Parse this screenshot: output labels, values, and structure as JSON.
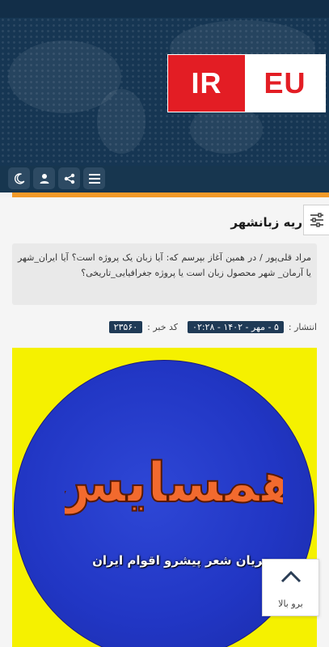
{
  "header": {
    "logo_left": "IR",
    "logo_right": "EU"
  },
  "toolbar": {
    "buttons": [
      {
        "icon": "moon-icon"
      },
      {
        "icon": "user-icon"
      },
      {
        "icon": "share-icon"
      },
      {
        "icon": "menu-icon"
      }
    ]
  },
  "article": {
    "title": "ریه زبانشهر",
    "summary": "مراد قلی‌پور / در همین آغاز بپرسم که: آیا زبان یک پروژه است؟ آیا ایران_شهر یا آرمان_ شهر محصول زبان است یا پروژه جغرافیایی_تاریخی؟",
    "published_label": "انتشار :",
    "published_value": "۵ - مهر - ۱۴۰۲ - ۰۲:۲۸",
    "code_label": "کد خبر :",
    "code_value": "۲۳۵۶۰"
  },
  "image": {
    "logo_text": "همسایس",
    "caption": "جریان شعر پیشرو اقوام ایران"
  },
  "back_to_top": {
    "label": "برو بالا"
  },
  "colors": {
    "header_bg": "#163653",
    "accent_orange": "#f29a28",
    "logo_red": "#e31d24",
    "image_yellow": "#f5f100",
    "image_blue": "#2136c4"
  }
}
